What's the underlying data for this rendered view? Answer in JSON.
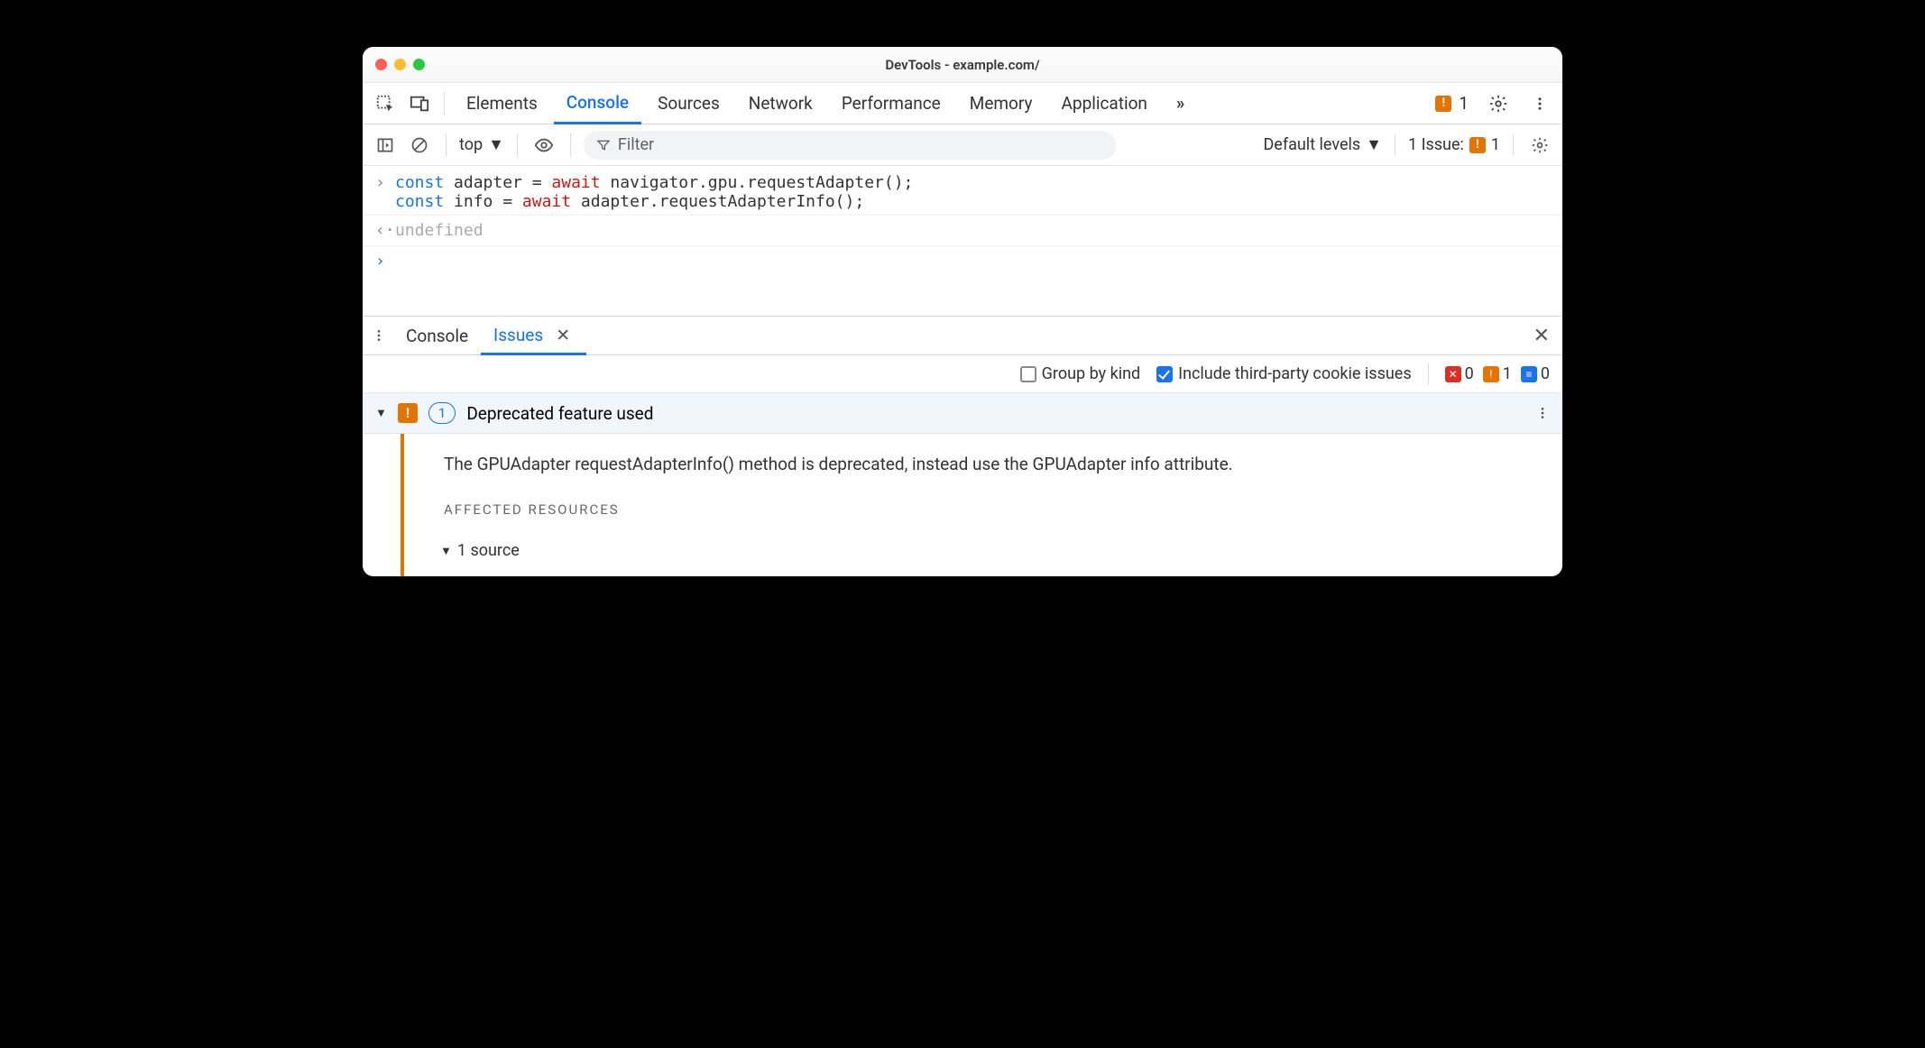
{
  "window": {
    "title": "DevTools - example.com/"
  },
  "tabs": {
    "items": [
      "Elements",
      "Console",
      "Sources",
      "Network",
      "Performance",
      "Memory",
      "Application"
    ],
    "active": "Console",
    "warn_count": "1"
  },
  "toolbar": {
    "context": "top",
    "filter_placeholder": "Filter",
    "levels": "Default levels",
    "issue_label": "1 Issue:",
    "issue_count": "1"
  },
  "console": {
    "input_line1_prefix": "const",
    "input_line1_var": " adapter = ",
    "input_line1_await": "await",
    "input_line1_rest": " navigator.gpu.requestAdapter();",
    "input_line2_prefix": "const",
    "input_line2_var": " info = ",
    "input_line2_await": "await",
    "input_line2_rest": " adapter.requestAdapterInfo();",
    "output": "undefined"
  },
  "drawer": {
    "tabs": [
      "Console",
      "Issues"
    ],
    "active": "Issues",
    "group_by_kind": "Group by kind",
    "include_third_party": "Include third-party cookie issues",
    "counts": {
      "error": "0",
      "warn": "1",
      "info": "0"
    }
  },
  "issue": {
    "count": "1",
    "title": "Deprecated feature used",
    "description": "The GPUAdapter requestAdapterInfo() method is deprecated, instead use the GPUAdapter info attribute.",
    "affected_label": "Affected Resources",
    "source_label": "1 source"
  }
}
